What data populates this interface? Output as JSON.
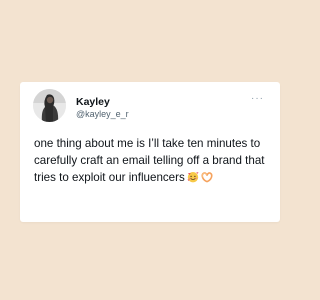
{
  "colors": {
    "background": "#f3e3d0",
    "card": "#ffffff",
    "text": "#0f1419",
    "secondary_text": "#536471"
  },
  "tweet": {
    "author_name": "Kayley",
    "author_handle": "@kayley_e_r",
    "more_label": "···",
    "text": "one thing about me is I’ll take ten minutes to carefully craft an email telling off a brand that tries to exploit our influencers",
    "emojis": [
      "smiling-face-with-hearts-icon",
      "heart-hands-icon"
    ]
  }
}
